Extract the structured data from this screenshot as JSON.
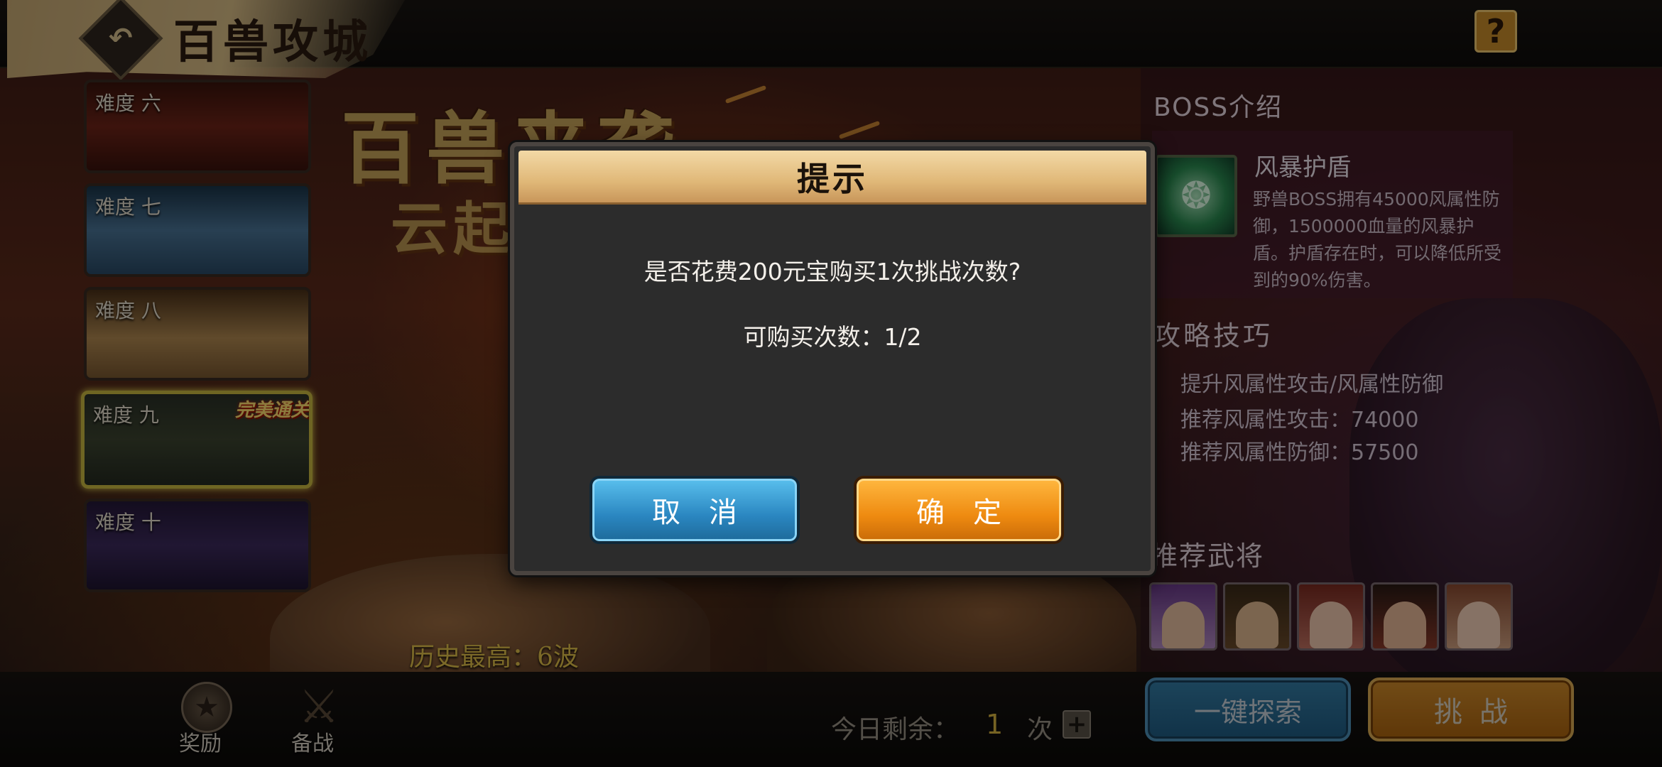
{
  "header": {
    "title": "百兽攻城",
    "help_label": "?"
  },
  "background": {
    "banner_line1": "百兽来袭",
    "banner_line2": "云起"
  },
  "difficulties": [
    {
      "label": "难度 六"
    },
    {
      "label": "难度 七"
    },
    {
      "label": "难度 八"
    },
    {
      "label": "难度 九",
      "badge": "完美通关",
      "selected": true
    },
    {
      "label": "难度 十"
    }
  ],
  "boss": {
    "heading": "BOSS介绍",
    "skill_name": "风暴护盾",
    "skill_desc": "野兽BOSS拥有45000风属性防御，1500000血量的风暴护盾。护盾存在时，可以降低所受到的90%伤害。"
  },
  "tips": {
    "heading": "攻略技巧",
    "lines": [
      "提升风属性攻击/风属性防御",
      "推荐风属性攻击：74000",
      "推荐风属性防御：57500"
    ]
  },
  "recommended": {
    "heading": "推荐武将",
    "hero_count": 5
  },
  "history": "历史最高：6波",
  "bottom": {
    "reward_label": "奖励",
    "prep_label": "备战",
    "remain_label": "今日剩余：",
    "remain_count": "1",
    "remain_unit": "次",
    "explore_label": "一键探索",
    "challenge_label": "挑战"
  },
  "dialog": {
    "title": "提示",
    "message": "是否花费200元宝购买1次挑战次数?",
    "count_text": "可购买次数：1/2",
    "cancel_label": "取消",
    "ok_label": "确定"
  },
  "colors": {
    "accent_gold": "#e0c04a",
    "ok_orange": "#ee8a10",
    "cancel_blue": "#2a86c0",
    "selected_border": "#c8b840"
  }
}
